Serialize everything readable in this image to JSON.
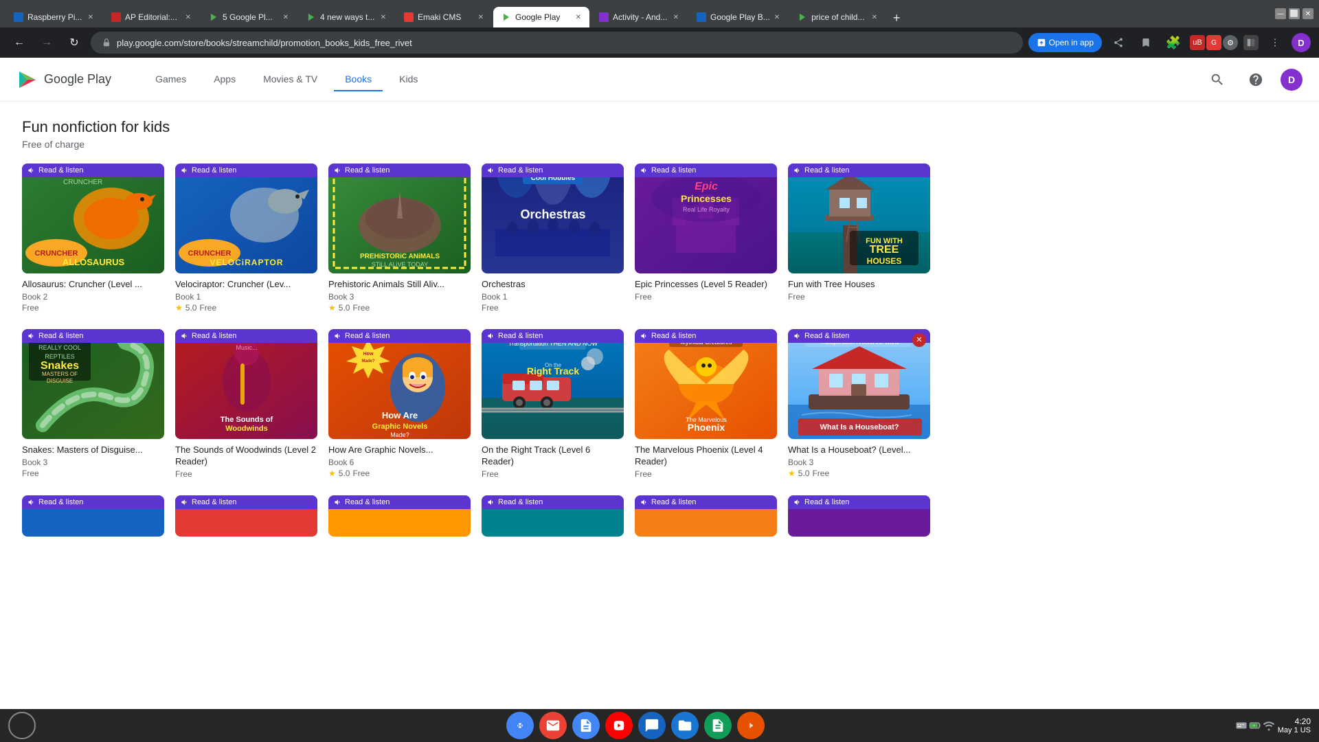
{
  "browser": {
    "tabs": [
      {
        "id": "rpi",
        "label": "Raspberry Pi...",
        "favicon_color": "#1565c0",
        "active": false
      },
      {
        "id": "ap",
        "label": "AP Editorial:...",
        "favicon_color": "#c62828",
        "active": false
      },
      {
        "id": "5gplay",
        "label": "5 Google Pl...",
        "favicon_color": "#4caf50",
        "active": false
      },
      {
        "id": "4new",
        "label": "4 new ways t...",
        "favicon_color": "#4caf50",
        "active": false
      },
      {
        "id": "emaki",
        "label": "Emaki CMS",
        "favicon_color": "#e53935",
        "active": false
      },
      {
        "id": "gplay",
        "label": "Google Play",
        "favicon_color": "#4caf50",
        "active": true
      },
      {
        "id": "activity",
        "label": "Activity - And...",
        "favicon_color": "#8430ce",
        "active": false
      },
      {
        "id": "gplaybk",
        "label": "Google Play B...",
        "favicon_color": "#1565c0",
        "active": false
      },
      {
        "id": "pricechild",
        "label": "price of child...",
        "favicon_color": "#4caf50",
        "active": false
      }
    ],
    "address": "play.google.com/store/books/streamchild/promotion_books_kids_free_rivet",
    "open_in_app": "Open in app"
  },
  "nav": {
    "logo_text": "Google Play",
    "items": [
      {
        "label": "Games",
        "active": false
      },
      {
        "label": "Apps",
        "active": false
      },
      {
        "label": "Movies & TV",
        "active": false
      },
      {
        "label": "Books",
        "active": true
      },
      {
        "label": "Kids",
        "active": false
      }
    ]
  },
  "section": {
    "title": "Fun nonfiction for kids",
    "subtitle": "Free of charge"
  },
  "read_listen_label": "Read & listen",
  "row1": [
    {
      "title": "Allosaurus: Cruncher (Level ...",
      "book_label": "Book 2",
      "rating": "",
      "price": "Free",
      "cover_type": "allosaurus"
    },
    {
      "title": "Velociraptor: Cruncher (Lev...",
      "book_label": "Book 1",
      "rating": "5.0",
      "price": "Free",
      "cover_type": "velociraptor"
    },
    {
      "title": "Prehistoric Animals Still Aliv...",
      "book_label": "Book 3",
      "rating": "5.0",
      "price": "Free",
      "cover_type": "prehistoric"
    },
    {
      "title": "Orchestras",
      "book_label": "Book 1",
      "rating": "",
      "price": "Free",
      "cover_type": "orchestras"
    },
    {
      "title": "Epic Princesses (Level 5 Reader)",
      "book_label": "",
      "rating": "",
      "price": "Free",
      "cover_type": "princesses"
    },
    {
      "title": "Fun with Tree Houses",
      "book_label": "",
      "rating": "",
      "price": "Free",
      "cover_type": "treehouses"
    }
  ],
  "row2": [
    {
      "title": "Snakes: Masters of Disguise...",
      "book_label": "Book 3",
      "rating": "",
      "price": "Free",
      "cover_type": "snakes"
    },
    {
      "title": "The Sounds of Woodwinds (Level 2 Reader)",
      "book_label": "",
      "rating": "",
      "price": "Free",
      "cover_type": "woodwinds"
    },
    {
      "title": "How Are Graphic Novels...",
      "book_label": "Book 6",
      "rating": "5.0",
      "price": "Free",
      "cover_type": "graphic"
    },
    {
      "title": "On the Right Track (Level 6 Reader)",
      "book_label": "",
      "rating": "",
      "price": "Free",
      "cover_type": "righttrack"
    },
    {
      "title": "The Marvelous Phoenix (Level 4 Reader)",
      "book_label": "",
      "rating": "",
      "price": "Free",
      "cover_type": "phoenix"
    },
    {
      "title": "What Is a Houseboat? (Level...",
      "book_label": "Book 3",
      "rating": "5.0",
      "price": "Free",
      "cover_type": "houseboat",
      "has_x": true
    }
  ],
  "taskbar": {
    "time": "4:20",
    "date": "May 1",
    "region": "US"
  }
}
